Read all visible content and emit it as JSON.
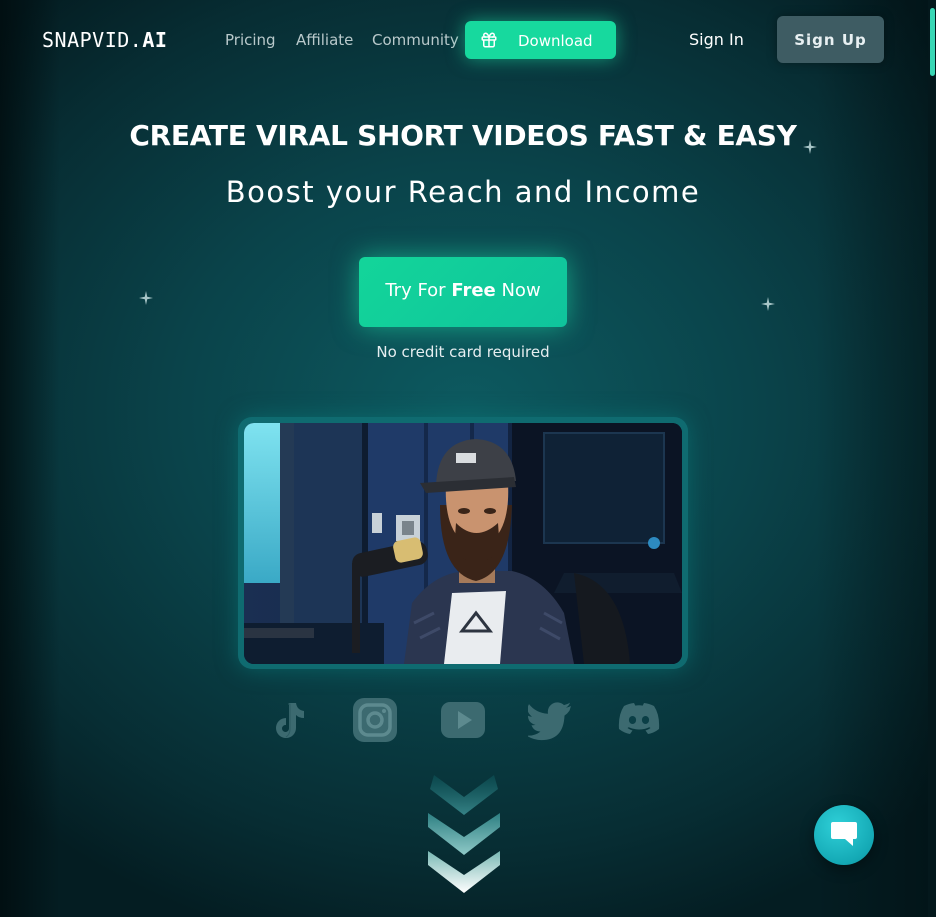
{
  "nav": {
    "logo_text": "SNAPVID.",
    "logo_bold": "AI",
    "links": [
      "Pricing",
      "Affiliate",
      "Community"
    ],
    "download_label": "Download",
    "signin_label": "Sign In",
    "signup_label": "Sign Up"
  },
  "hero": {
    "headline": "CREATE VIRAL SHORT VIDEOS FAST & EASY",
    "subheadline": "Boost your Reach and Income",
    "cta_prefix": "Try For ",
    "cta_bold": "Free",
    "cta_suffix": " Now",
    "cta_note": "No credit card required"
  },
  "social": {
    "icons": [
      "tiktok-icon",
      "instagram-icon",
      "youtube-icon",
      "twitter-icon",
      "discord-icon"
    ]
  },
  "colors": {
    "accent": "#17d99e",
    "background": "#0a434a",
    "chat": "#14a9b5"
  }
}
